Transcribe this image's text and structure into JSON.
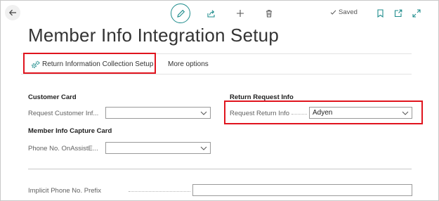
{
  "header": {
    "saved_label": "Saved"
  },
  "page": {
    "title": "Member Info Integration Setup"
  },
  "actions": {
    "return_info_setup": "Return Information Collection Setup",
    "more_options": "More options"
  },
  "customer_card": {
    "title": "Customer Card",
    "request_customer_info_label": "Request Customer Inf...",
    "request_customer_info_value": ""
  },
  "member_info_capture_card": {
    "title": "Member Info Capture Card",
    "phone_onassist_label": "Phone No. OnAssistE...",
    "phone_onassist_value": ""
  },
  "return_request_info": {
    "title": "Return Request Info",
    "request_return_info_label": "Request Return Info",
    "request_return_info_value": "Adyen"
  },
  "general": {
    "implicit_phone_prefix_label": "Implicit Phone No. Prefix",
    "implicit_phone_prefix_value": ""
  },
  "colors": {
    "accent": "#1e8c8c",
    "highlight": "#e0141e"
  }
}
